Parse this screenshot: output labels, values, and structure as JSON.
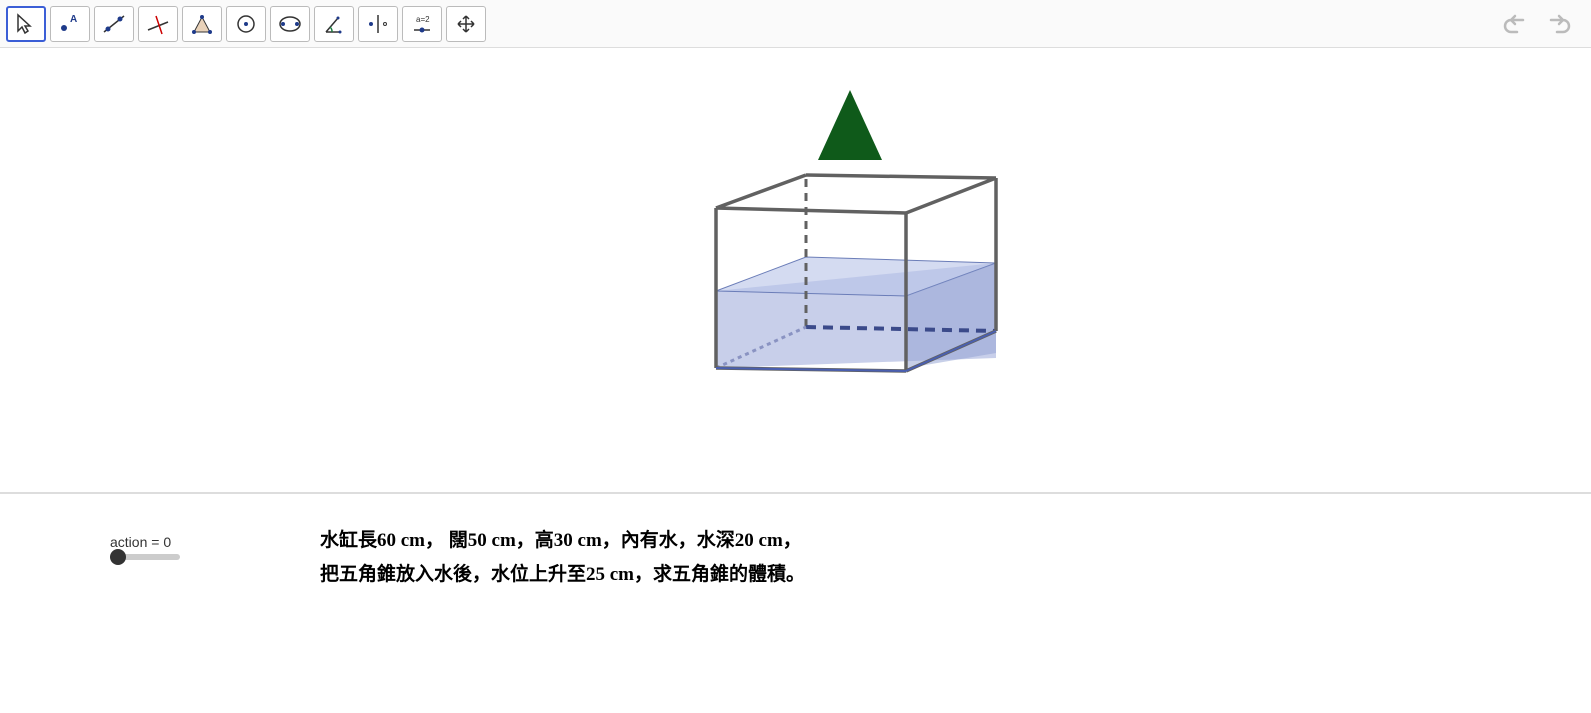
{
  "toolbar": {
    "tools": [
      {
        "name": "move-tool",
        "sel": true
      },
      {
        "name": "point-tool"
      },
      {
        "name": "line-tool"
      },
      {
        "name": "perpendicular-tool"
      },
      {
        "name": "polygon-tool"
      },
      {
        "name": "circle-tool"
      },
      {
        "name": "ellipse-tool"
      },
      {
        "name": "angle-tool"
      },
      {
        "name": "reflect-tool"
      },
      {
        "name": "slider-tool",
        "label": "a=2"
      },
      {
        "name": "move-view-tool"
      }
    ]
  },
  "slider": {
    "label": "action = 0",
    "value": 0
  },
  "problem": {
    "line1": "水缸長60 cm， 闊50 cm，高30 cm，內有水，水深20 cm，",
    "line2": "把五角錐放入水後，水位上升至25 cm，求五角錐的體積。"
  },
  "geometry": {
    "tank_length_cm": 60,
    "tank_width_cm": 50,
    "tank_height_cm": 30,
    "water_depth_cm": 20,
    "water_after_cm": 25,
    "shape": "pentagonal_pyramid"
  }
}
